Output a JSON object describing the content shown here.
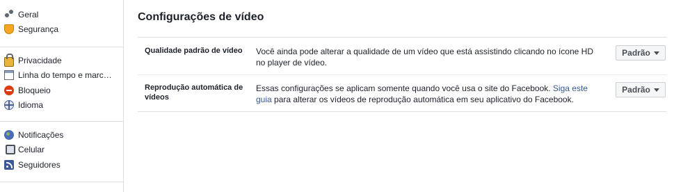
{
  "sidebar": {
    "groups": [
      {
        "items": [
          {
            "label": "Geral",
            "icon": "gears-icon"
          },
          {
            "label": "Segurança",
            "icon": "shield-icon"
          }
        ]
      },
      {
        "items": [
          {
            "label": "Privacidade",
            "icon": "lock-icon"
          },
          {
            "label": "Linha do tempo e marc…",
            "icon": "timeline-icon"
          },
          {
            "label": "Bloqueio",
            "icon": "block-icon"
          },
          {
            "label": "Idioma",
            "icon": "globe-icon"
          }
        ]
      },
      {
        "items": [
          {
            "label": "Notificações",
            "icon": "world-icon"
          },
          {
            "label": "Celular",
            "icon": "phone-icon"
          },
          {
            "label": "Seguidores",
            "icon": "rss-icon"
          }
        ]
      }
    ]
  },
  "main": {
    "title": "Configurações de vídeo",
    "rows": [
      {
        "label": "Qualidade padrão de vídeo",
        "description": "Você ainda pode alterar a qualidade de um vídeo que está assistindo clicando no ícone HD no player de vídeo.",
        "button": "Padrão"
      },
      {
        "label": "Reprodução automática de vídeos",
        "description_before": "Essas configurações se aplicam somente quando você usa o site do Facebook. ",
        "link": "Siga este guia",
        "description_after": " para alterar os vídeos de reprodução automática em seu aplicativo do Facebook.",
        "button": "Padrão"
      }
    ]
  },
  "colors": {
    "link": "#365899",
    "border": "#dddfe2",
    "text": "#1d2129"
  }
}
